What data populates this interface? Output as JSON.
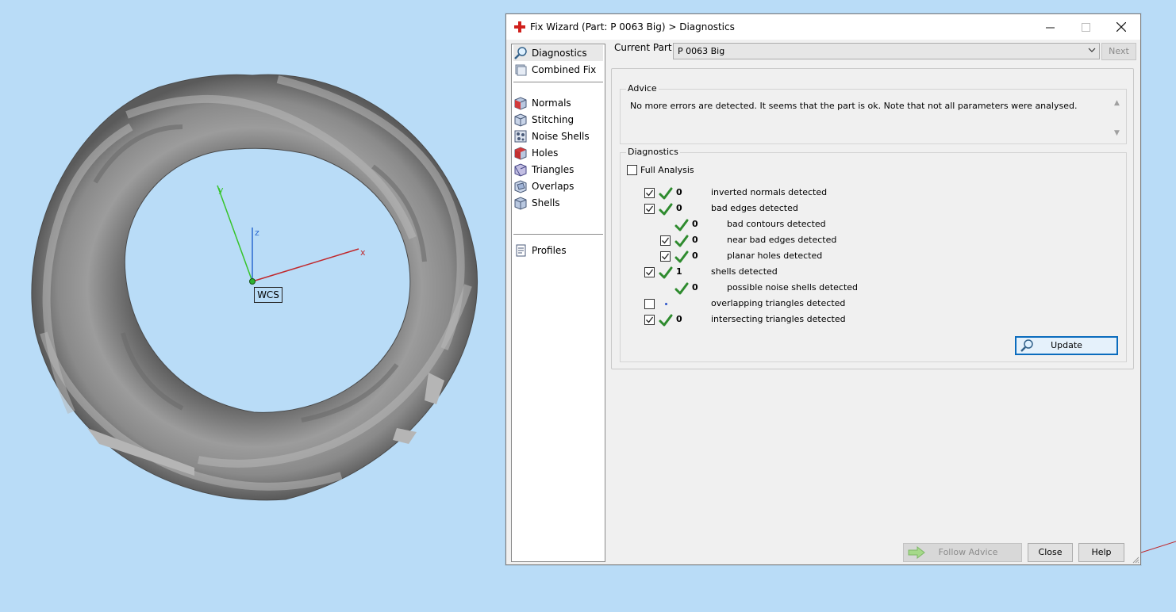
{
  "viewport": {
    "wcs_label": "WCS",
    "axis_x": "x",
    "axis_y": "y",
    "axis_z": "z"
  },
  "dialog": {
    "title": "Fix Wizard (Part: P 0063 Big) > Diagnostics",
    "nav": [
      {
        "label": "Diagnostics",
        "icon": "magnifier-icon",
        "selected": true
      },
      {
        "label": "Combined Fix",
        "icon": "combined-fix-icon"
      },
      {
        "label": "Normals",
        "icon": "normals-cube-icon"
      },
      {
        "label": "Stitching",
        "icon": "stitching-cube-icon"
      },
      {
        "label": "Noise Shells",
        "icon": "noise-shells-icon"
      },
      {
        "label": "Holes",
        "icon": "holes-cube-icon"
      },
      {
        "label": "Triangles",
        "icon": "triangles-cube-icon"
      },
      {
        "label": "Overlaps",
        "icon": "overlaps-cube-icon"
      },
      {
        "label": "Shells",
        "icon": "shells-cube-icon"
      },
      {
        "label": "Profiles",
        "icon": "profiles-document-icon"
      }
    ],
    "current_part_label": "Current Part:",
    "current_part_value": "P 0063 Big",
    "next_label": "Next",
    "advice": {
      "title": "Advice",
      "text": "No more errors are detected. It seems that the part is ok. Note that not all parameters were analysed."
    },
    "diagnostics": {
      "title": "Diagnostics",
      "full_analysis_label": "Full Analysis",
      "full_analysis_checked": false,
      "rows": [
        {
          "checkbox": true,
          "checked": true,
          "status": "ok",
          "count": "0",
          "label": "inverted normals detected",
          "indent": 0
        },
        {
          "checkbox": true,
          "checked": true,
          "status": "ok",
          "count": "0",
          "label": "bad edges detected",
          "indent": 0
        },
        {
          "checkbox": false,
          "checked": false,
          "status": "ok",
          "count": "0",
          "label": "bad contours detected",
          "indent": 1
        },
        {
          "checkbox": true,
          "checked": true,
          "status": "ok",
          "count": "0",
          "label": "near bad edges detected",
          "indent": 1
        },
        {
          "checkbox": true,
          "checked": true,
          "status": "ok",
          "count": "0",
          "label": "planar holes detected",
          "indent": 1
        },
        {
          "checkbox": true,
          "checked": true,
          "status": "ok",
          "count": "1",
          "label": "shells detected",
          "indent": 0
        },
        {
          "checkbox": false,
          "checked": false,
          "status": "ok",
          "count": "0",
          "label": "possible noise shells detected",
          "indent": 1
        },
        {
          "checkbox": true,
          "checked": false,
          "status": "pending",
          "count": "",
          "label": "overlapping triangles detected",
          "indent": 0
        },
        {
          "checkbox": true,
          "checked": true,
          "status": "ok",
          "count": "0",
          "label": "intersecting triangles detected",
          "indent": 0
        }
      ],
      "update_label": "Update"
    },
    "buttons": {
      "follow_advice": "Follow Advice",
      "close": "Close",
      "help": "Help"
    }
  },
  "colors": {
    "background": "#b9dcf7",
    "ok_tick": "#2e8b2e",
    "axis_x": "#c0282c",
    "axis_y": "#36c42a",
    "axis_z": "#2a6ad0",
    "title_icon": "#d0201c"
  }
}
